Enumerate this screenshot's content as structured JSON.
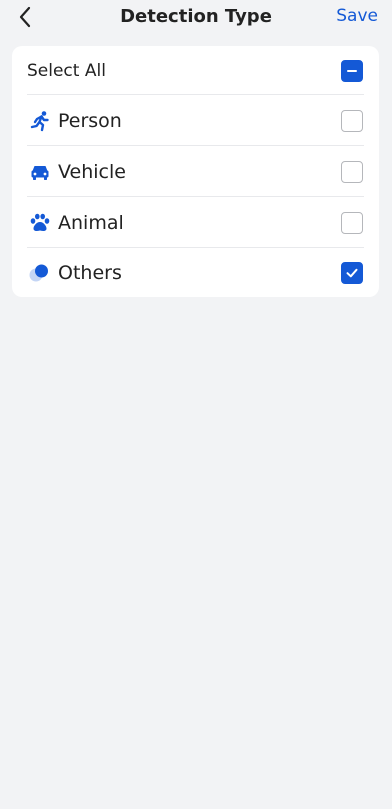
{
  "header": {
    "title": "Detection Type",
    "save_label": "Save",
    "back_icon": "chevron-left-icon"
  },
  "select_all": {
    "label": "Select All",
    "state": "indeterminate"
  },
  "items": [
    {
      "label": "Person",
      "icon": "running-person-icon",
      "checked": false
    },
    {
      "label": "Vehicle",
      "icon": "car-icon",
      "checked": false
    },
    {
      "label": "Animal",
      "icon": "paw-icon",
      "checked": false
    },
    {
      "label": "Others",
      "icon": "circles-icon",
      "checked": true
    }
  ],
  "colors": {
    "accent": "#1459d6",
    "background": "#f2f3f5",
    "card": "#ffffff"
  }
}
